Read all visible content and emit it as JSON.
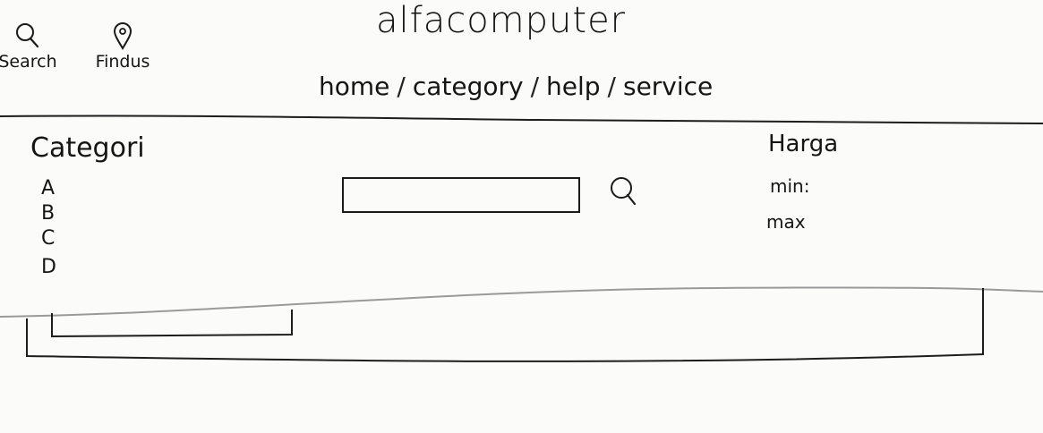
{
  "header": {
    "brand": "alfacomputer",
    "utility": [
      {
        "label": "Search",
        "icon": "search-icon"
      },
      {
        "label": "Findus",
        "icon": "location-pin-icon"
      }
    ],
    "nav": [
      "home",
      "category",
      "help",
      "service"
    ],
    "nav_separator": "/"
  },
  "sidebar": {
    "title": "Categori",
    "items": [
      "A",
      "B",
      "C",
      "D"
    ]
  },
  "search": {
    "value": "",
    "icon": "search-icon"
  },
  "price_filter": {
    "title": "Harga",
    "min_label": "min:",
    "max_label": "max"
  }
}
